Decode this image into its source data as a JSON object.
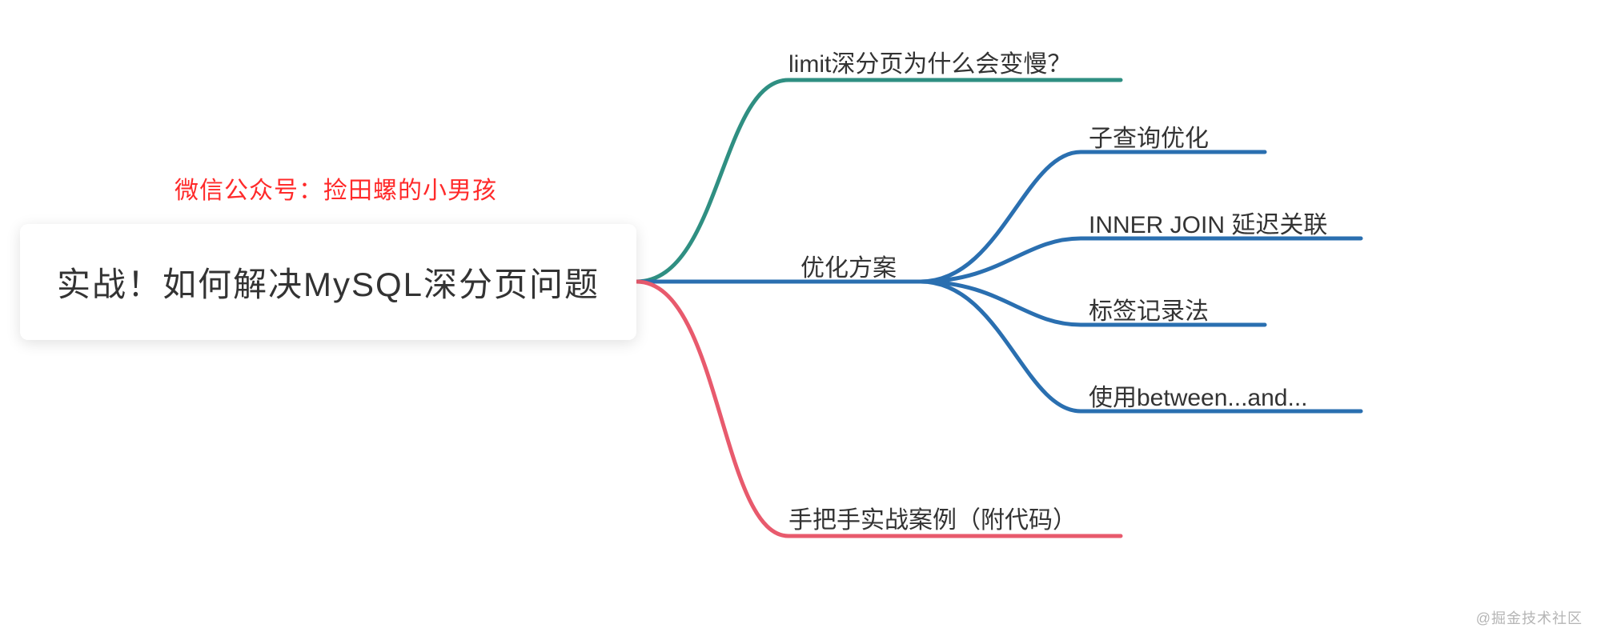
{
  "root": {
    "title": "实战！如何解决MySQL深分页问题",
    "subtitle": "微信公众号：捡田螺的小男孩"
  },
  "branches": {
    "b1": {
      "label": "limit深分页为什么会变慢？"
    },
    "b2": {
      "label": "优化方案",
      "children": {
        "c1": {
          "label": "子查询优化"
        },
        "c2": {
          "label": "INNER JOIN 延迟关联"
        },
        "c3": {
          "label": "标签记录法"
        },
        "c4": {
          "label": "使用between...and..."
        }
      }
    },
    "b3": {
      "label": "手把手实战案例（附代码）"
    }
  },
  "colors": {
    "teal": "#2f8f82",
    "blue": "#2a6fb0",
    "red": "#e85a6d"
  },
  "watermark": "@掘金技术社区"
}
